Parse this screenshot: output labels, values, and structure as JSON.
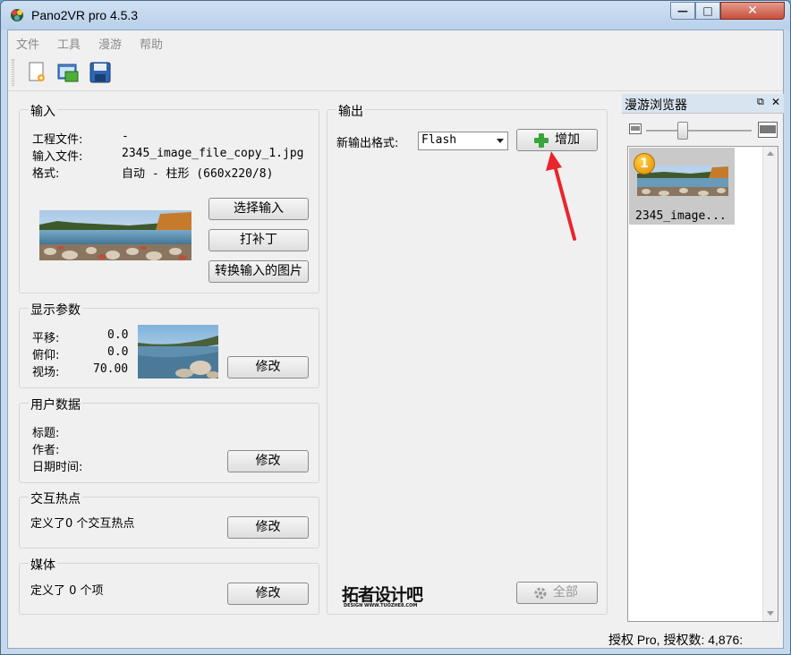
{
  "window": {
    "title": "Pano2VR pro 4.5.3",
    "minimize": "—",
    "maximize": "□",
    "close": "✕"
  },
  "menu": [
    "文件",
    "工具",
    "漫游",
    "帮助"
  ],
  "toolbar": {
    "icons": [
      "new-project-icon",
      "open-project-icon",
      "save-project-icon"
    ]
  },
  "input": {
    "title": "输入",
    "project_label": "工程文件:",
    "project_value": "-",
    "file_label": "输入文件:",
    "file_value": "2345_image_file_copy_1.jpg",
    "format_label": "格式:",
    "format_value": "自动 - 柱形 (660x220/8)",
    "select_btn": "选择输入",
    "patch_btn": "打补丁",
    "convert_btn": "转换输入的图片"
  },
  "display": {
    "title": "显示参数",
    "pan_label": "平移:",
    "pan_value": "0.0",
    "tilt_label": "俯仰:",
    "tilt_value": "0.0",
    "fov_label": "视场:",
    "fov_value": "70.00",
    "modify_btn": "修改"
  },
  "userdata": {
    "title": "用户数据",
    "title_label": "标题:",
    "author_label": "作者:",
    "datetime_label": "日期时间:",
    "modify_btn": "修改"
  },
  "hotspots": {
    "title": "交互热点",
    "text": "定义了0 个交互热点",
    "modify_btn": "修改"
  },
  "media": {
    "title": "媒体",
    "text": "定义了 0 个项",
    "modify_btn": "修改"
  },
  "output": {
    "title": "输出",
    "format_label": "新输出格式:",
    "format_value": "Flash",
    "add_btn": "增加",
    "all_btn": "全部",
    "watermark": "拓者设计吧",
    "watermark_sub": "DESIGN WWW.TUOZHE8.COM"
  },
  "tour_browser": {
    "title": "漫游浏览器",
    "item_label": "2345_image...",
    "badge": "1"
  },
  "status": {
    "text": "授权 Pro, 授权数: 4,876:"
  },
  "colors": {
    "arrow": "#e8262b",
    "add_plus": "#3aa53a"
  }
}
